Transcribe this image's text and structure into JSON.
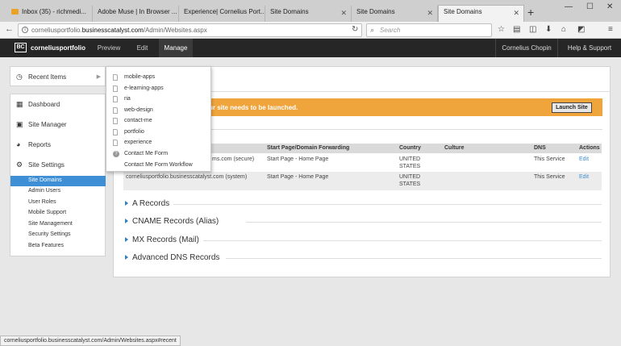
{
  "tabs": [
    {
      "label": "Inbox (35) - richmedi..."
    },
    {
      "label": "Adobe Muse | In Browser ..."
    },
    {
      "label": "Experience| Cornelius Port..."
    },
    {
      "label": "Site Domains"
    },
    {
      "label": "Site Domains"
    },
    {
      "label": "Site Domains"
    }
  ],
  "browser": {
    "url_prefix": "corneliusportfolio.",
    "url_domain": "businesscatalyst.com",
    "url_path": "/Admin/Websites.aspx",
    "search_placeholder": "Search",
    "status_url": "corneliusportfolio.businesscatalyst.com/Admin/Websites.aspx#recent"
  },
  "admin": {
    "logo": "BC",
    "site_name": "corneliusportfolio",
    "menu": [
      "Preview",
      "Edit",
      "Manage"
    ],
    "user": "Cornelius Chopin",
    "help": "Help & Support"
  },
  "sidebar": {
    "recent": "Recent Items",
    "items": [
      "Dashboard",
      "Site Manager",
      "Reports",
      "Site Settings"
    ],
    "subitems": [
      "Site Domains",
      "Admin Users",
      "User Roles",
      "Mobile Support",
      "Site Management",
      "Security Settings",
      "Beta Features"
    ]
  },
  "recent_menu": {
    "pages": [
      "mobile-apps",
      "e-learning-apps",
      "ria",
      "web-design",
      "contact-me",
      "portfolio",
      "experience"
    ],
    "forms": [
      "Contact Me Form",
      "Contact Me Form Workflow"
    ]
  },
  "main": {
    "banner_text": "ur site needs to be launched.",
    "launch_label": "Launch Site",
    "columns": [
      "Start Page/Domain Forwarding",
      "Country",
      "Culture",
      "DNS",
      "Actions"
    ],
    "rows": [
      {
        "domain": "ms.com (secure)",
        "start": "Start Page - Home Page",
        "country1": "UNITED",
        "country2": "STATES",
        "dns": "This Service",
        "action": "Edit"
      },
      {
        "domain": "corneliusportfolio.businesscatalyst.com (system)",
        "start": "Start Page - Home Page",
        "country1": "UNITED",
        "country2": "STATES",
        "dns": "This Service",
        "action": "Edit"
      }
    ],
    "sections": [
      "A Records",
      "CNAME Records (Alias)",
      "MX Records (Mail)",
      "Advanced DNS Records"
    ]
  }
}
